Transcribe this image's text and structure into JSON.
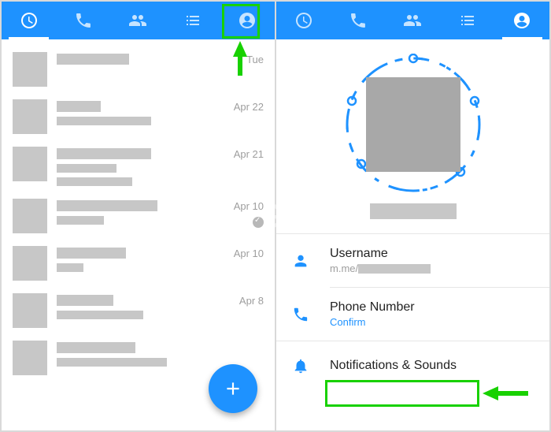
{
  "annotations": {
    "highlight_profile_tab": true,
    "highlight_notifications_row": true
  },
  "watermark": "MOBIGYAAN",
  "left": {
    "tabs": [
      "recent",
      "calls",
      "people",
      "groups",
      "profile"
    ],
    "active_tab_index": 0,
    "fab_icon": "plus",
    "chats": [
      {
        "date": "Tue",
        "name_w": 92,
        "lines": []
      },
      {
        "date": "Apr 22",
        "name_w": 56,
        "lines": [
          120
        ]
      },
      {
        "date": "Apr 21",
        "name_w": 120,
        "lines": [
          76,
          96
        ]
      },
      {
        "date": "Apr 10",
        "name_w": 128,
        "lines": [
          60
        ],
        "read": true
      },
      {
        "date": "Apr 10",
        "name_w": 88,
        "lines": [
          34
        ]
      },
      {
        "date": "Apr 8",
        "name_w": 72,
        "lines": [
          110
        ]
      },
      {
        "date": "",
        "name_w": 100,
        "lines": [
          140
        ]
      }
    ]
  },
  "right": {
    "tabs": [
      "recent",
      "calls",
      "people",
      "groups",
      "profile"
    ],
    "active_tab_index": 4,
    "rows": {
      "username": {
        "title": "Username",
        "prefix": "m.me/"
      },
      "phone": {
        "title": "Phone Number",
        "action": "Confirm"
      },
      "notif": {
        "title": "Notifications & Sounds"
      }
    }
  }
}
